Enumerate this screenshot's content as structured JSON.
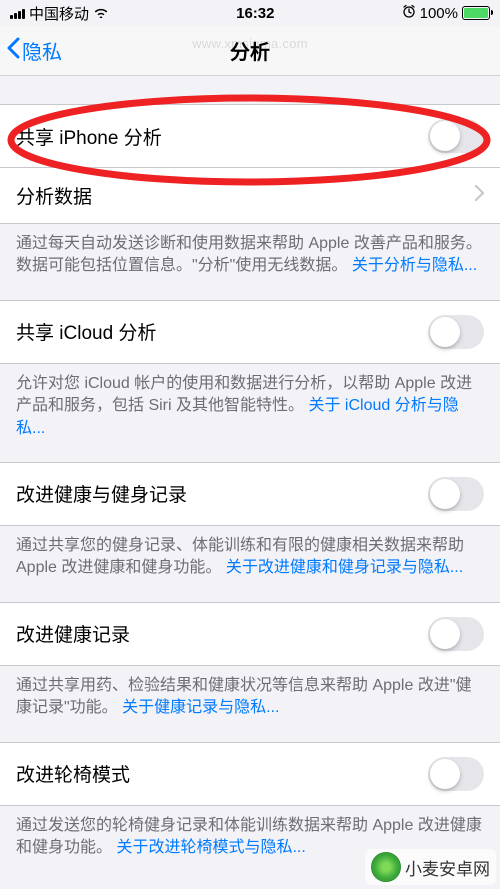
{
  "status": {
    "carrier": "中国移动",
    "time": "16:32",
    "battery": "100%"
  },
  "nav": {
    "back": "隐私",
    "title": "分析"
  },
  "sections": {
    "shareIphone": {
      "title": "共享 iPhone 分析"
    },
    "analyticsData": {
      "title": "分析数据"
    },
    "shareIphoneFooter": {
      "text": "通过每天自动发送诊断和使用数据来帮助 Apple 改善产品和服务。数据可能包括位置信息。\"分析\"使用无线数据。",
      "link": "关于分析与隐私..."
    },
    "shareIcloud": {
      "title": "共享 iCloud 分析"
    },
    "shareIcloudFooter": {
      "text": "允许对您 iCloud 帐户的使用和数据进行分析，以帮助 Apple 改进产品和服务，包括 Siri 及其他智能特性。",
      "link": "关于 iCloud 分析与隐私..."
    },
    "healthFitness": {
      "title": "改进健康与健身记录"
    },
    "healthFitnessFooter": {
      "text": "通过共享您的健身记录、体能训练和有限的健康相关数据来帮助 Apple 改进健康和健身功能。",
      "link": "关于改进健康和健身记录与隐私..."
    },
    "healthRecord": {
      "title": "改进健康记录"
    },
    "healthRecordFooter": {
      "text": "通过共享用药、检验结果和健康状况等信息来帮助 Apple 改进\"健康记录\"功能。",
      "link": "关于健康记录与隐私..."
    },
    "wheelchair": {
      "title": "改进轮椅模式"
    },
    "wheelchairFooter": {
      "text": "通过发送您的轮椅健身记录和体能训练数据来帮助 Apple 改进健康和健身功能。",
      "link": "关于改进轮椅模式与隐私..."
    }
  },
  "watermark": {
    "topUrl": "www.xmsigma.com",
    "brand": "小麦安卓网"
  }
}
